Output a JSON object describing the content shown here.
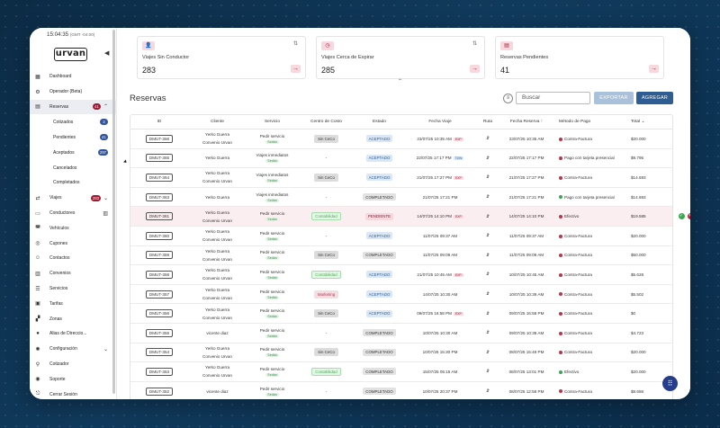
{
  "clock": {
    "time": "15:04:35",
    "zone": "(GMT -04:00)"
  },
  "logo": "urvan",
  "sidebar": {
    "items": [
      {
        "label": "Dashboard",
        "icon": "grid-icon"
      },
      {
        "label": "Operador (Beta)",
        "icon": "operator-icon"
      },
      {
        "label": "Reservas",
        "icon": "calendar-icon",
        "badge": "41",
        "active": true,
        "chevron": "^"
      },
      {
        "label": "Cotizados",
        "sub": true,
        "badge": "2"
      },
      {
        "label": "Pendientes",
        "sub": true,
        "badge": "41"
      },
      {
        "label": "Aceptados",
        "sub": true,
        "badge": "297"
      },
      {
        "label": "Cancelados",
        "sub": true
      },
      {
        "label": "Completados",
        "sub": true
      },
      {
        "label": "Viajes",
        "icon": "trips-icon",
        "badge": "283",
        "chevron": "v"
      },
      {
        "label": "Conductores",
        "icon": "drivers-icon",
        "extra": "map"
      },
      {
        "label": "Vehículos",
        "icon": "car-icon"
      },
      {
        "label": "Cupones",
        "icon": "coupon-icon"
      },
      {
        "label": "Contactos",
        "icon": "contacts-icon"
      },
      {
        "label": "Convenios",
        "icon": "agreements-icon"
      },
      {
        "label": "Servicios",
        "icon": "services-icon"
      },
      {
        "label": "Tarifas",
        "icon": "rates-icon"
      },
      {
        "label": "Zonas",
        "icon": "zones-icon"
      },
      {
        "label": "Alias de Direccio...",
        "icon": "pin-icon"
      },
      {
        "label": "Configuración",
        "icon": "settings-icon",
        "chevron": "v"
      },
      {
        "label": "Cotizador",
        "icon": "quote-icon"
      },
      {
        "label": "Soporte",
        "icon": "support-icon"
      },
      {
        "label": "Cerrar Sesión",
        "icon": "logout-icon"
      }
    ]
  },
  "cards": [
    {
      "title": "Viajes Sin Conductor",
      "value": "283"
    },
    {
      "title": "Viajes Cerca de Expirar",
      "value": "285"
    },
    {
      "title": "Reservas Pendientes",
      "value": "41"
    }
  ],
  "page": {
    "title": "Reservas",
    "search_placeholder": "Buscar",
    "export_label": "EXPORTAR",
    "add_label": "AGREGAR"
  },
  "columns": [
    "ID",
    "Cliente",
    "Servicio",
    "Centro de Costo",
    "Estado",
    "Fecha Viaje",
    "Ruta",
    "Fecha Reserva",
    "Método de Pago",
    "Total"
  ],
  "rows": [
    {
      "id": "DMUT-366",
      "cliente": [
        "Yerko Guerra",
        "Convenio Urvan"
      ],
      "servicio": "Pedir servicio",
      "tag": "Sedán",
      "cc": "Sin CeCo",
      "ccs": "gray",
      "estado": "ACEPTADO",
      "es": "ac",
      "fv": "23/07/25 10:35 AM",
      "exp": "EXP",
      "expc": "r",
      "fr": "23/07/25 10:35 AM",
      "mp": "Contra-Factura",
      "mpc": "red",
      "total": "$20.000"
    },
    {
      "id": "DMUT-365",
      "cliente": [
        "Yerko Guerra"
      ],
      "servicio": "Viajes inmediatos",
      "tag": "Sedán",
      "cc": "-",
      "ccs": "",
      "estado": "ACEPTADO",
      "es": "ac",
      "fv": "22/07/25 17:17 PM",
      "exp": "TDW",
      "expc": "b",
      "fr": "22/07/25 17:17 PM",
      "mp": "Pago con tarjeta presencial",
      "mpc": "red",
      "total": "$9.795"
    },
    {
      "id": "DMUT-364",
      "cliente": [
        "Yerko Guerra",
        "Convenio Urvan"
      ],
      "servicio": "Viajes inmediatos",
      "tag": "Sedán",
      "cc": "Sin CeCo",
      "ccs": "gray",
      "estado": "ACEPTADO",
      "es": "ac",
      "fv": "21/07/25 17:27 PM",
      "exp": "EXP",
      "expc": "r",
      "fr": "21/07/25 17:27 PM",
      "mp": "Contra-Factura",
      "mpc": "red",
      "total": "$14.693"
    },
    {
      "id": "DMUT-363",
      "cliente": [
        "Yerko Guerra"
      ],
      "servicio": "Viajes inmediatos",
      "tag": "Sedán",
      "cc": "-",
      "ccs": "",
      "estado": "COMPLETADO",
      "es": "co",
      "fv": "21/07/25 17:21 PM",
      "exp": "",
      "expc": "",
      "fr": "21/07/25 17:21 PM",
      "mp": "Pago con tarjeta presencial",
      "mpc": "green",
      "total": "$14.693"
    },
    {
      "id": "DMUT-361",
      "cliente": [
        "Yerko Guerra",
        "Convenio Urvan"
      ],
      "servicio": "Pedir servicio",
      "tag": "Sedán",
      "cc": "Contabilidad",
      "ccs": "green",
      "estado": "PENDIENTE",
      "es": "pe",
      "fv": "14/07/25 14:10 PM",
      "exp": "EXP",
      "expc": "r",
      "fr": "14/07/25 14:10 PM",
      "mp": "Efectivo",
      "mpc": "red",
      "total": "$19.585",
      "hl": true,
      "actions": true
    },
    {
      "id": "DMUT-360",
      "cliente": [
        "Yerko Guerra",
        "Convenio Urvan"
      ],
      "servicio": "Pedir servicio",
      "tag": "Sedán",
      "cc": "-",
      "ccs": "",
      "estado": "ACEPTADO",
      "es": "ac",
      "fv": "11/07/25 09:37 AM",
      "exp": "",
      "expc": "",
      "fr": "11/07/25 09:37 AM",
      "mp": "Contra-Factura",
      "mpc": "red",
      "total": "$20.000"
    },
    {
      "id": "DMUT-359",
      "cliente": [
        "Yerko Guerra",
        "Convenio Urvan"
      ],
      "servicio": "Pedir servicio",
      "tag": "Sedán",
      "cc": "Sin CeCo",
      "ccs": "gray",
      "estado": "COMPLETADO",
      "es": "co",
      "fv": "11/07/25 09:09 AM",
      "exp": "",
      "expc": "",
      "fr": "11/07/25 09:09 AM",
      "mp": "Contra-Factura",
      "mpc": "red",
      "total": "$50.000"
    },
    {
      "id": "DMUT-358",
      "cliente": [
        "Yerko Guerra",
        "Convenio Urvan"
      ],
      "servicio": "Pedir servicio",
      "tag": "Sedán",
      "cc": "Contabilidad",
      "ccs": "green",
      "estado": "ACEPTADO",
      "es": "ac",
      "fv": "21/07/25 10:45 AM",
      "exp": "EXP",
      "expc": "r",
      "fr": "10/07/25 10:45 AM",
      "mp": "Contra-Factura",
      "mpc": "red",
      "total": "$5.628"
    },
    {
      "id": "DMUT-357",
      "cliente": [
        "Yerko Guerra",
        "Convenio Urvan"
      ],
      "servicio": "Pedir servicio",
      "tag": "Sedán",
      "cc": "Marketing",
      "ccs": "pink",
      "estado": "ACEPTADO",
      "es": "ac",
      "fv": "14/07/25 10:30 AM",
      "exp": "",
      "expc": "",
      "fr": "10/07/25 10:39 AM",
      "mp": "Contra-Factura",
      "mpc": "red",
      "total": "$5.502"
    },
    {
      "id": "DMUT-356",
      "cliente": [
        "Yerko Guerra",
        "Convenio Urvan"
      ],
      "servicio": "Pedir servicio",
      "tag": "Sedán",
      "cc": "Sin CeCo",
      "ccs": "gray",
      "estado": "ACEPTADO",
      "es": "ac",
      "fv": "09/07/25 16:58 PM",
      "exp": "EXP",
      "expc": "r",
      "fr": "09/07/25 16:58 PM",
      "mp": "Contra-Factura",
      "mpc": "red",
      "total": "$0"
    },
    {
      "id": "DMUT-355",
      "cliente": [
        "vicente diaz"
      ],
      "servicio": "Pedir servicio",
      "tag": "Sedán",
      "cc": "-",
      "ccs": "",
      "estado": "COMPLETADO",
      "es": "co",
      "fv": "10/07/25 10:30 AM",
      "exp": "",
      "expc": "",
      "fr": "09/07/25 10:38 AM",
      "mp": "Contra-Factura",
      "mpc": "red",
      "total": "$4.723"
    },
    {
      "id": "DMUT-354",
      "cliente": [
        "Yerko Guerra",
        "Convenio Urvan"
      ],
      "servicio": "Pedir servicio",
      "tag": "Sedán",
      "cc": "Sin CeCo",
      "ccs": "gray",
      "estado": "COMPLETADO",
      "es": "co",
      "fv": "10/07/25 15:30 PM",
      "exp": "",
      "expc": "",
      "fr": "08/07/25 15:48 PM",
      "mp": "Contra-Factura",
      "mpc": "red",
      "total": "$20.000"
    },
    {
      "id": "DMUT-353",
      "cliente": [
        "Yerko Guerra",
        "Convenio Urvan"
      ],
      "servicio": "Pedir servicio",
      "tag": "Sedán",
      "cc": "Contabilidad",
      "ccs": "green",
      "estado": "COMPLETADO",
      "es": "co",
      "fv": "15/07/25 05:15 AM",
      "exp": "",
      "expc": "",
      "fr": "08/07/25 13:01 PM",
      "mp": "Efectivo",
      "mpc": "green",
      "total": "$20.000"
    },
    {
      "id": "DMUT-352",
      "cliente": [
        "vicente diaz"
      ],
      "servicio": "Pedir servicio",
      "tag": "Sedán",
      "cc": "-",
      "ccs": "",
      "estado": "COMPLETADO",
      "es": "co",
      "fv": "10/07/25 20:37 PM",
      "exp": "",
      "expc": "",
      "fr": "08/07/25 12:58 PM",
      "mp": "Contra-Factura",
      "mpc": "red",
      "total": "$8.688"
    }
  ]
}
